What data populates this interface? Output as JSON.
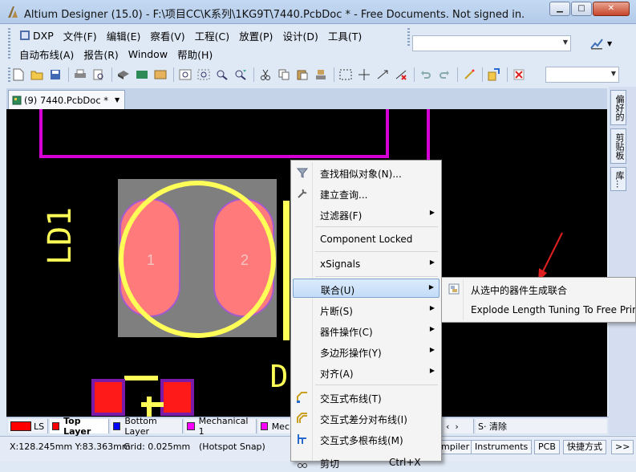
{
  "window": {
    "title": "Altium Designer (15.0) - F:\\项目CC\\K系列\\1KG9T\\7440.PcbDoc * - Free Documents. Not signed in.",
    "minimize_label": "▁",
    "maximize_label": "□",
    "close_label": "✕"
  },
  "menubar": {
    "row1": [
      "DXP",
      "文件(F)",
      "编辑(E)",
      "察看(V)",
      "工程(C)",
      "放置(P)",
      "设计(D)",
      "工具(T)"
    ],
    "row2": [
      "自动布线(A)",
      "报告(R)",
      "Window",
      "帮助(H)"
    ]
  },
  "document_tab": {
    "label": "(9) 7440.PcbDoc *"
  },
  "right_panels": [
    "偏好的",
    "剪贴板",
    "库..."
  ],
  "pcb": {
    "designator": "LD1",
    "pad1_label": "1",
    "pad2_label": "2",
    "partial_designator": "D",
    "colors": {
      "keepout": "#d400d4",
      "silkscreen": "#ffff57",
      "pad": "#ff7a7a",
      "pad_bg": "#7f7f7f",
      "top_layer": "#ff0000"
    }
  },
  "context_menu": {
    "items": [
      {
        "label": "查找相似对象(N)...",
        "icon": "funnel-icon",
        "submenu": false
      },
      {
        "label": "建立查询...",
        "icon": "wrench-icon",
        "submenu": false
      },
      {
        "label": "过滤器(F)",
        "icon": "",
        "submenu": true
      },
      {
        "label": "Component Locked",
        "icon": "",
        "submenu": false
      },
      {
        "label": "xSignals",
        "icon": "",
        "submenu": true
      },
      {
        "label": "联合(U)",
        "icon": "",
        "submenu": true,
        "highlighted": true
      },
      {
        "label": "片断(S)",
        "icon": "",
        "submenu": true
      },
      {
        "label": "器件操作(C)",
        "icon": "",
        "submenu": true
      },
      {
        "label": "多边形操作(Y)",
        "icon": "",
        "submenu": true
      },
      {
        "label": "对齐(A)",
        "icon": "",
        "submenu": true
      },
      {
        "label": "交互式布线(T)",
        "icon": "route-icon",
        "submenu": false
      },
      {
        "label": "交互式差分对布线(I)",
        "icon": "diff-pair-route-icon",
        "submenu": false
      },
      {
        "label": "交互式多根布线(M)",
        "icon": "multi-route-icon",
        "submenu": false
      },
      {
        "label": "剪切",
        "shortcut": "Ctrl+X",
        "icon": "cut-icon",
        "submenu": false
      }
    ]
  },
  "submenu": {
    "items": [
      {
        "label": "从选中的器件生成联合",
        "icon": "union-icon"
      },
      {
        "label": "Explode Length Tuning To Free Primitives",
        "icon": ""
      }
    ]
  },
  "layers": {
    "ls_label": "LS",
    "tabs": [
      {
        "label": "Top Layer",
        "color": "#ff0000",
        "active": true
      },
      {
        "label": "Bottom Layer",
        "color": "#0000ff",
        "active": false
      },
      {
        "label": "Mechanical 1",
        "color": "#ff00ff",
        "active": false
      },
      {
        "label": "Mec",
        "color": "#ff00ff",
        "active": false
      }
    ],
    "right_fragment": "S· 清除"
  },
  "statusbar": {
    "coords": "X:128.245mm Y:83.363mm",
    "grid": "Grid: 0.025mm",
    "snap": "(Hotspot Snap)",
    "panels": [
      "mpiler",
      "Instruments",
      "PCB",
      "快捷方式",
      ">>"
    ]
  }
}
